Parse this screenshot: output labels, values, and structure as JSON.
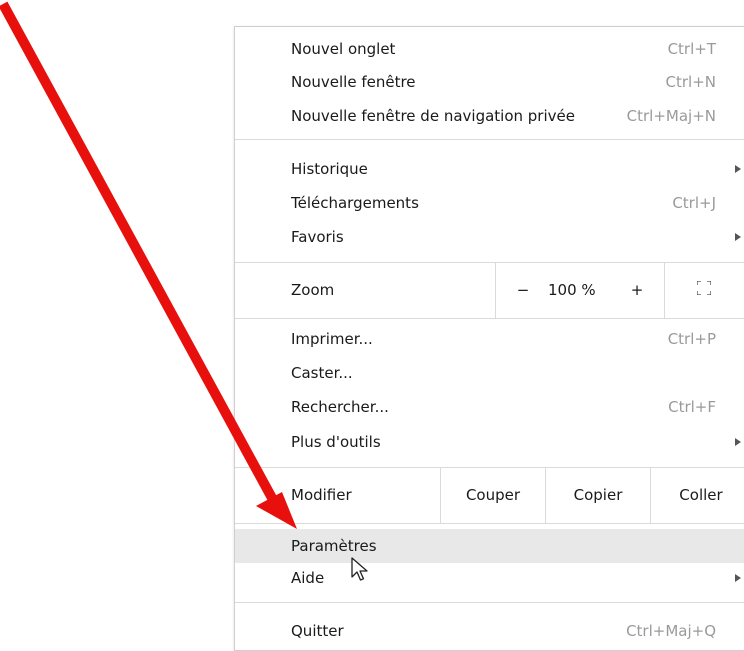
{
  "menu": {
    "group1": [
      {
        "label": "Nouvel onglet",
        "shortcut": "Ctrl+T"
      },
      {
        "label": "Nouvelle fenêtre",
        "shortcut": "Ctrl+N"
      },
      {
        "label": "Nouvelle fenêtre de navigation privée",
        "shortcut": "Ctrl+Maj+N"
      }
    ],
    "group2": [
      {
        "label": "Historique",
        "submenu": true
      },
      {
        "label": "Téléchargements",
        "shortcut": "Ctrl+J"
      },
      {
        "label": "Favoris",
        "submenu": true
      }
    ],
    "zoom": {
      "label": "Zoom",
      "minus": "−",
      "value": "100 %",
      "plus": "+"
    },
    "group3": [
      {
        "label": "Imprimer...",
        "shortcut": "Ctrl+P"
      },
      {
        "label": "Caster..."
      },
      {
        "label": "Rechercher...",
        "shortcut": "Ctrl+F"
      },
      {
        "label": "Plus d'outils",
        "submenu": true
      }
    ],
    "edit": {
      "label": "Modifier",
      "cut": "Couper",
      "copy": "Copier",
      "paste": "Coller"
    },
    "group4": [
      {
        "label": "Paramètres",
        "highlighted": true
      },
      {
        "label": "Aide",
        "submenu": true
      }
    ],
    "quit": {
      "label": "Quitter",
      "shortcut": "Ctrl+Maj+Q"
    }
  },
  "annotation": {
    "arrow_color": "#e8100d",
    "points_to": "Paramètres"
  },
  "colors": {
    "highlight": "#e8e8e8",
    "shortcut_text": "#9a9a9a",
    "separator": "#dadada"
  }
}
